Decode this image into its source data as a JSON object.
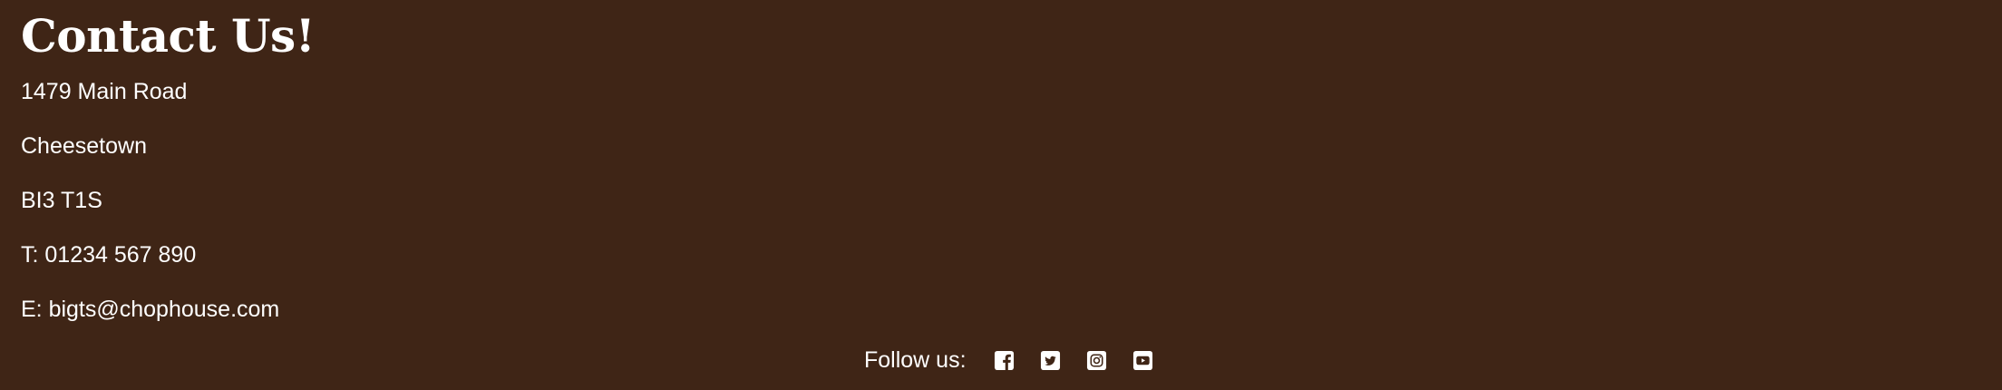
{
  "contact": {
    "heading": "Contact Us!",
    "address_line1": "1479 Main Road",
    "address_line2": "Cheesetown",
    "postcode": "BI3 T1S",
    "phone": "T: 01234 567 890",
    "email": "E: bigts@chophouse.com"
  },
  "footer": {
    "follow_label": "Follow us:",
    "social_icons": [
      "facebook-icon",
      "twitter-icon",
      "instagram-icon",
      "youtube-icon"
    ]
  },
  "colors": {
    "background": "#3f2516",
    "text": "#ffffff"
  }
}
